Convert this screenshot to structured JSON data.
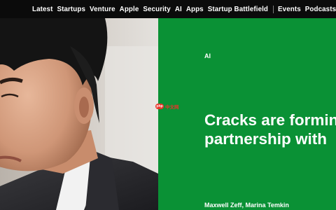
{
  "nav": {
    "items": [
      "Latest",
      "Startups",
      "Venture",
      "Apple",
      "Security",
      "AI",
      "Apps",
      "Startup Battlefield"
    ],
    "items_after_separator": [
      "Events",
      "Podcasts"
    ]
  },
  "article": {
    "category": "AI",
    "headline_line1": "Cracks are forming",
    "headline_line2": "partnership with",
    "authors": "Maxwell Zeff, Marina Temkin"
  },
  "photo": {
    "description_icon": "portrait-photo"
  },
  "watermark": {
    "logo": "php",
    "text": "中文网"
  },
  "colors": {
    "nav_background": "#0b0b0b",
    "accent_green": "#0a9135",
    "text_white": "#ffffff"
  }
}
